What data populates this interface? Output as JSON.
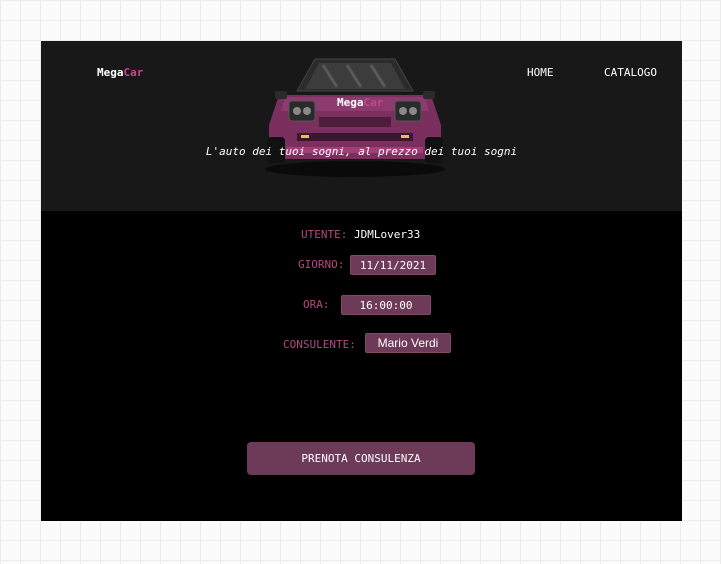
{
  "header": {
    "brand_prefix": "Mega",
    "brand_suffix": "Car",
    "nav": {
      "home": "HOME",
      "catalog": "CATALOGO"
    },
    "hero_brand_prefix": "Mega",
    "hero_brand_suffix": "Car",
    "tagline": "L'auto dei tuoi sogni, al prezzo dei tuoi sogni"
  },
  "form": {
    "user_label": "UTENTE:",
    "user_value": "JDMLover33",
    "day_label": "GIORNO:",
    "day_value": "11/11/2021",
    "time_label": "ORA:",
    "time_value": "16:00:00",
    "consultant_label": "CONSULENTE:",
    "consultant_value": "Mario Verdi",
    "submit_label": "PRENOTA CONSULENZA"
  },
  "colors": {
    "accent": "#c04a86",
    "field_bg": "#6d3a57",
    "header_bg": "#181818",
    "page_bg": "#000000"
  }
}
